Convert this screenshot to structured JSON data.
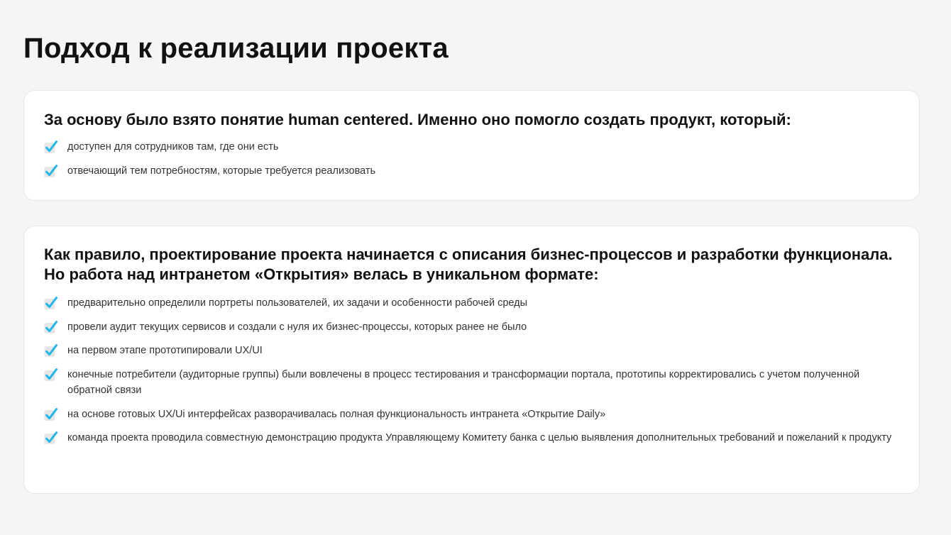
{
  "page": {
    "title": "Подход к реализации проекта"
  },
  "colors": {
    "background": "#f5f5f5",
    "card": "#ffffff",
    "check_accent": "#1fb6e8",
    "check_box": "#e6e6e6"
  },
  "card1": {
    "heading": "За основу было взято понятие human centered. Именно оно помогло создать продукт, который:",
    "items": [
      {
        "text": "доступен для сотрудников там, где они есть",
        "icon": "checkbox-checked-icon"
      },
      {
        "text": "отвечающий тем потребностям, которые требуется реализовать",
        "icon": "checkbox-checked-icon"
      }
    ]
  },
  "card2": {
    "heading": "Как правило, проектирование проекта начинается с описания бизнес-процессов и разработки функционала. Но работа над интранетом «Открытия» велась в уникальном формате:",
    "items": [
      {
        "text": "предварительно определили портреты пользователей, их задачи и особенности рабочей среды",
        "icon": "checkbox-checked-icon"
      },
      {
        "text": "провели аудит текущих сервисов и создали с нуля их бизнес-процессы, которых ранее не было",
        "icon": "checkbox-checked-icon"
      },
      {
        "text": "на первом этапе прототипировали UX/UI",
        "icon": "checkbox-checked-icon"
      },
      {
        "text": "конечные потребители (аудиторные группы) были вовлечены в процесс тестирования и трансформации портала, прототипы корректировались с учетом полученной обратной связи",
        "icon": "checkbox-checked-icon"
      },
      {
        "text": "на основе готовых UX/Ui интерфейсах разворачивалась полная функциональность интранета «Открытие Daily»",
        "icon": "checkbox-checked-icon"
      },
      {
        "text": "команда проекта проводила совместную демонстрацию продукта Управляющему Комитету банка с целью выявления дополнительных требований и пожеланий к продукту",
        "icon": "checkbox-checked-icon"
      }
    ]
  }
}
